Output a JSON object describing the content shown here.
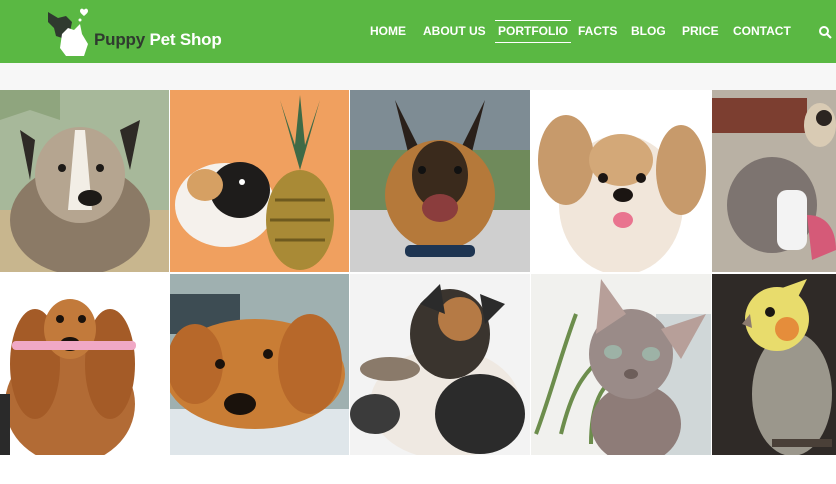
{
  "brand": {
    "name_part1": "Puppy",
    "name_part2": " Pet Shop",
    "logo_icon": "dog-cat-heart-logo"
  },
  "colors": {
    "header_green": "#5ab843",
    "nav_text": "#ffffff",
    "subbar": "#f7f7f7"
  },
  "nav": {
    "items": [
      {
        "label": "HOME",
        "active": false
      },
      {
        "label": "ABOUT US",
        "active": false
      },
      {
        "label": "PORTFOLIO",
        "active": true
      },
      {
        "label": "FACTS",
        "active": false
      },
      {
        "label": "BLOG",
        "active": false
      },
      {
        "label": "PRICE",
        "active": false
      },
      {
        "label": "CONTACT",
        "active": false
      }
    ],
    "search_icon": "search-icon"
  },
  "gallery": {
    "rows": [
      [
        "Mixed-breed dog in grass",
        "Guinea pig next to pineapple",
        "German shepherd",
        "Shih tzu puppy",
        "Cat beside pet bed"
      ],
      [
        "Dachshund holding toothbrush",
        "Golden retriever lying down",
        "Border collie scratching",
        "Sphynx cat with plant",
        "Cockatiel parrot"
      ]
    ]
  }
}
